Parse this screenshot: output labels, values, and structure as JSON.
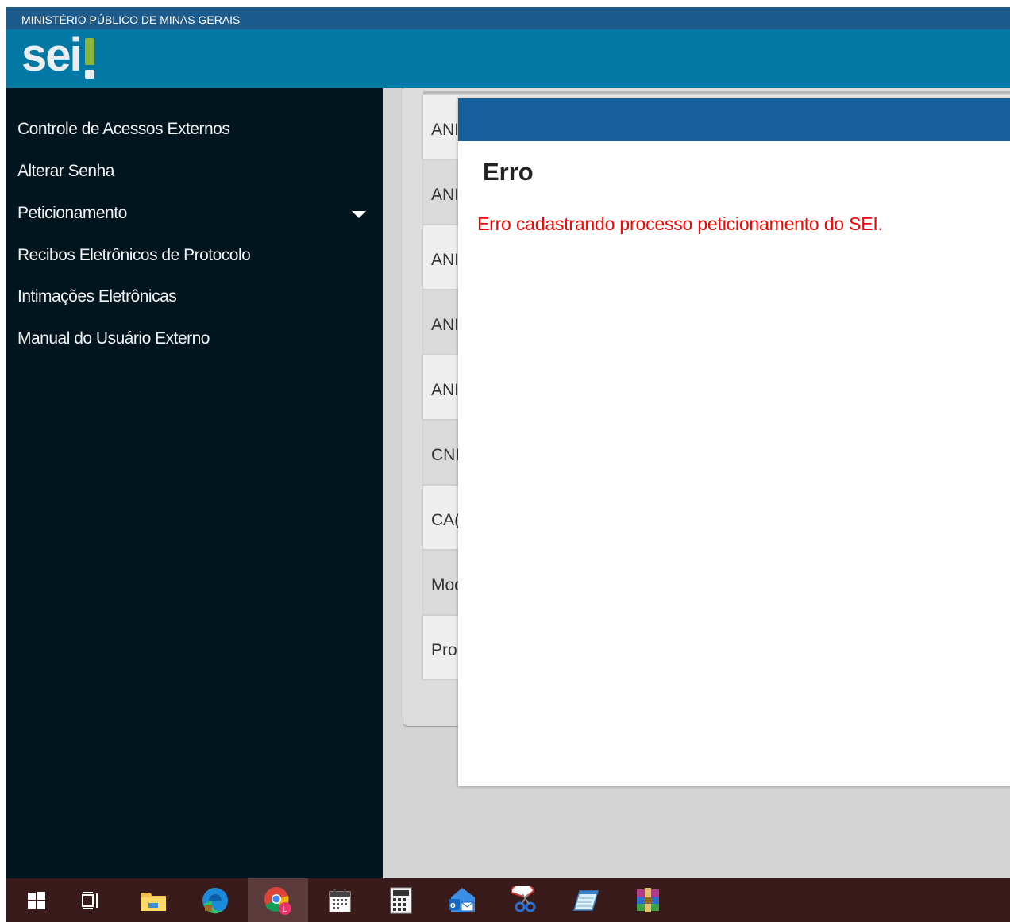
{
  "header": {
    "org_name": "MINISTÉRIO PÚBLICO DE MINAS GERAIS",
    "logo_text": "sei"
  },
  "sidebar": {
    "items": [
      {
        "label": "Controle de Acessos Externos"
      },
      {
        "label": "Alterar Senha"
      },
      {
        "label": "Peticionamento"
      },
      {
        "label": "Recibos Eletrônicos de Protocolo"
      },
      {
        "label": "Intimações Eletrônicas"
      },
      {
        "label": "Manual do Usuário Externo"
      }
    ]
  },
  "background_table": {
    "rows": [
      "ANI",
      "ANI",
      "ANI",
      "ANI",
      "ANI",
      "CNI",
      "CA(",
      "Moc",
      "Pro"
    ]
  },
  "dialog": {
    "title": "Erro",
    "message": "Erro cadastrando processo peticionamento do SEI."
  },
  "taskbar": {
    "apps": [
      "start-windows-icon",
      "task-view-icon",
      "file-explorer-icon",
      "edge-browser-icon",
      "chrome-browser-icon",
      "calendar-icon",
      "calculator-icon",
      "outlook-mail-icon",
      "snipping-tool-icon",
      "notepad-icon",
      "winrar-icon"
    ],
    "active_app": "chrome-browser-icon"
  },
  "colors": {
    "topbar": "#1d5b8c",
    "brandbar": "#0478a4",
    "sidebar": "#00151e",
    "dialog_titlebar": "#155f9c",
    "error_text": "#ff0000",
    "logo_accent": "#8ab43c"
  }
}
